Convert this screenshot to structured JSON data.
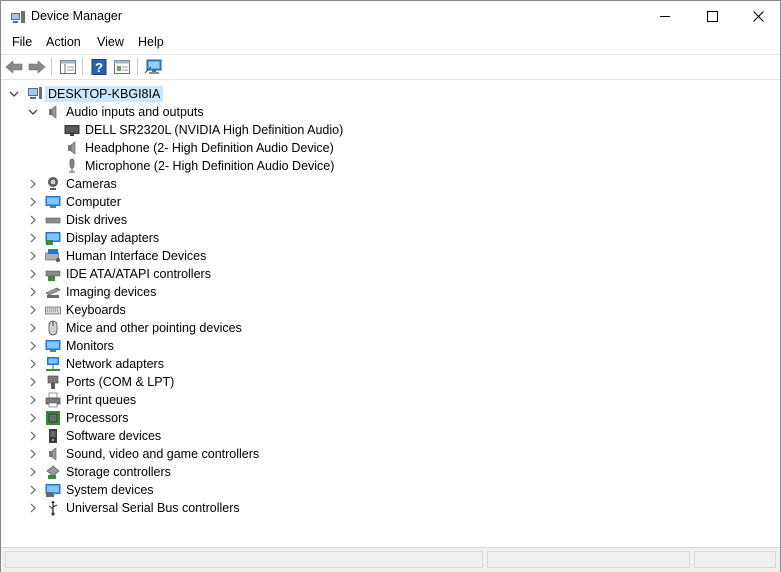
{
  "window": {
    "title": "Device Manager"
  },
  "menu": {
    "file": "File",
    "action": "Action",
    "view": "View",
    "help": "Help"
  },
  "tree": {
    "root": "DESKTOP-KBGI8IA",
    "audio": {
      "label": "Audio inputs and outputs",
      "children": [
        "DELL SR2320L (NVIDIA High Definition Audio)",
        "Headphone (2- High Definition Audio Device)",
        "Microphone (2- High Definition Audio Device)"
      ]
    },
    "categories": [
      "Cameras",
      "Computer",
      "Disk drives",
      "Display adapters",
      "Human Interface Devices",
      "IDE ATA/ATAPI controllers",
      "Imaging devices",
      "Keyboards",
      "Mice and other pointing devices",
      "Monitors",
      "Network adapters",
      "Ports (COM & LPT)",
      "Print queues",
      "Processors",
      "Software devices",
      "Sound, video and game controllers",
      "Storage controllers",
      "System devices",
      "Universal Serial Bus controllers"
    ]
  },
  "colors": {
    "selection": "#cce8ff",
    "accent": "#1a73c7"
  }
}
